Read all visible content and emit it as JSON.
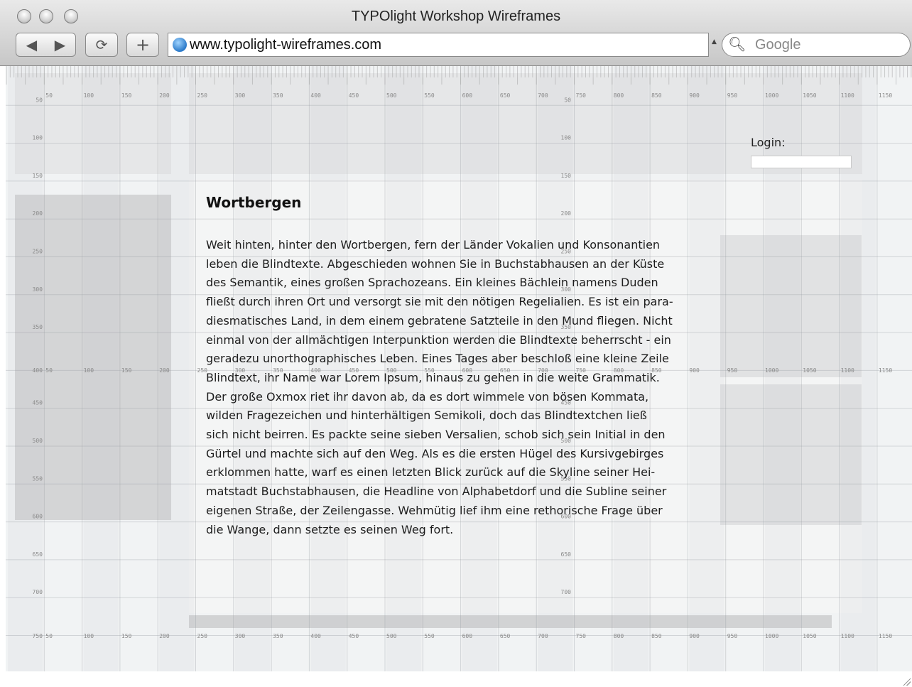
{
  "window": {
    "title": "TYPOlight Workshop Wireframes"
  },
  "toolbar": {
    "back_icon": "back-arrow-icon",
    "forward_icon": "forward-arrow-icon",
    "reload_glyph": "⟳",
    "add_glyph": "+",
    "address": "www.typolight-wireframes.com",
    "search_placeholder": "Google"
  },
  "ruler": {
    "x_ticks": [
      "50",
      "100",
      "150",
      "200",
      "250",
      "300",
      "350",
      "400",
      "450",
      "500",
      "550",
      "600",
      "650",
      "700",
      "750",
      "800",
      "850",
      "900",
      "950",
      "1000",
      "1050",
      "1100",
      "1150"
    ],
    "y_ticks": [
      "50",
      "100",
      "150",
      "200",
      "250",
      "300",
      "350",
      "400",
      "450",
      "500",
      "550",
      "600",
      "650",
      "700",
      "750"
    ]
  },
  "page": {
    "login_label": "Login:",
    "heading": "Wortbergen",
    "article_lines": [
      "Weit hinten, hinter den Wortbergen, fern der Länder Vokalien und Konsonantien",
      "leben die Blindtexte. Abgeschieden wohnen Sie in Buchstabhausen an der Küste",
      "des Semantik, eines großen Sprachozeans. Ein kleines Bächlein namens Duden",
      "fließt durch ihren Ort und versorgt sie mit den nötigen Regelialien. Es ist ein para-",
      "diesmatisches Land, in dem einem gebratene Satzteile in den Mund fliegen. Nicht",
      "einmal von der allmächtigen Interpunktion werden die Blindtexte beherrscht - ein",
      "geradezu unorthographisches Leben. Eines Tages aber beschloß eine kleine Zeile",
      "Blindtext, ihr Name war Lorem Ipsum, hinaus zu gehen in die weite Grammatik.",
      "Der große Oxmox riet ihr davon ab, da es dort wimmele von bösen Kommata,",
      "wilden Fragezeichen und hinterhältigen Semikoli, doch das Blindtextchen ließ",
      "sich nicht beirren. Es packte seine sieben Versalien, schob sich sein Initial in den",
      "Gürtel und machte sich auf den Weg. Als es die ersten Hügel des Kursivgebirges",
      "erklommen hatte, warf es einen letzten Blick zurück auf die Skyline seiner Hei-",
      "matstadt Buchstabhausen, die Headline von Alphabetdorf und die Subline seiner",
      "eigenen Straße, der Zeilengasse. Wehmütig lief ihm eine rethorische Frage über",
      "die Wange, dann setzte es seinen Weg fort."
    ]
  }
}
